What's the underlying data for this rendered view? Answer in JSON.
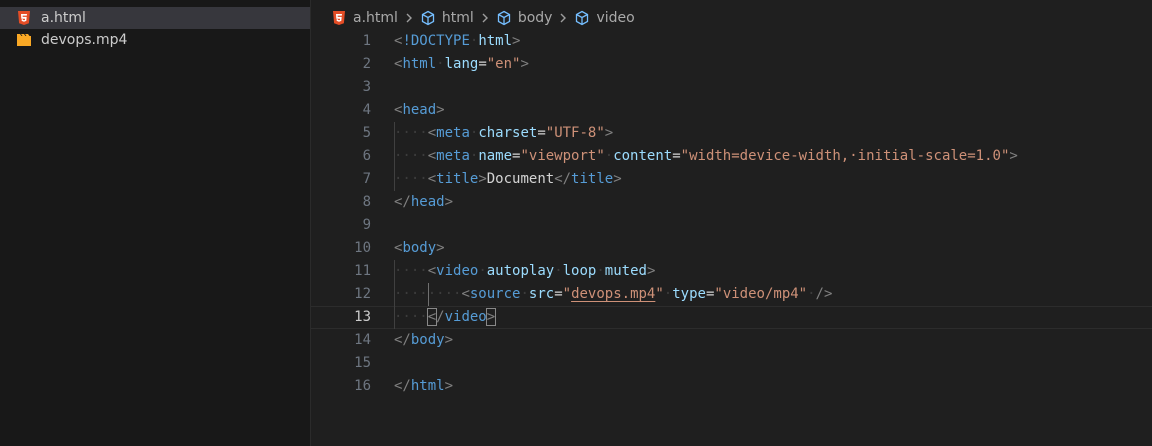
{
  "explorer": {
    "files": [
      {
        "name": "a.html",
        "icon": "html5-icon",
        "selected": true
      },
      {
        "name": "devops.mp4",
        "icon": "video-file-icon",
        "selected": false
      }
    ]
  },
  "breadcrumb": {
    "file": "a.html",
    "items": [
      "html",
      "body",
      "video"
    ]
  },
  "colors": {
    "tag": "#569cd6",
    "attribute": "#9cdcfe",
    "string": "#ce9178",
    "punctuation": "#808080",
    "text": "#d4d4d4",
    "line_number": "#6e7681",
    "html_icon": "#e44d26",
    "video_icon": "#f9a825"
  },
  "code": {
    "current_line": 13,
    "lines": [
      {
        "n": "1",
        "tokens": [
          [
            "pun",
            "<"
          ],
          [
            "tag",
            "!DOCTYPE"
          ],
          [
            "ws",
            "·"
          ],
          [
            "att",
            "html"
          ],
          [
            "pun",
            ">"
          ]
        ]
      },
      {
        "n": "2",
        "tokens": [
          [
            "pun",
            "<"
          ],
          [
            "tag",
            "html"
          ],
          [
            "ws",
            "·"
          ],
          [
            "att",
            "lang"
          ],
          [
            "plain",
            "="
          ],
          [
            "str",
            "\"en\""
          ],
          [
            "pun",
            ">"
          ]
        ]
      },
      {
        "n": "3",
        "tokens": []
      },
      {
        "n": "4",
        "tokens": [
          [
            "pun",
            "<"
          ],
          [
            "tag",
            "head"
          ],
          [
            "pun",
            ">"
          ]
        ]
      },
      {
        "n": "5",
        "tokens": [
          [
            "ws",
            "····"
          ],
          [
            "pun",
            "<"
          ],
          [
            "tag",
            "meta"
          ],
          [
            "ws",
            "·"
          ],
          [
            "att",
            "charset"
          ],
          [
            "plain",
            "="
          ],
          [
            "str",
            "\"UTF-8\""
          ],
          [
            "pun",
            ">"
          ]
        ]
      },
      {
        "n": "6",
        "tokens": [
          [
            "ws",
            "····"
          ],
          [
            "pun",
            "<"
          ],
          [
            "tag",
            "meta"
          ],
          [
            "ws",
            "·"
          ],
          [
            "att",
            "name"
          ],
          [
            "plain",
            "="
          ],
          [
            "str",
            "\"viewport\""
          ],
          [
            "ws",
            "·"
          ],
          [
            "att",
            "content"
          ],
          [
            "plain",
            "="
          ],
          [
            "str",
            "\"width=device-width,·initial-scale=1.0\""
          ],
          [
            "pun",
            ">"
          ]
        ]
      },
      {
        "n": "7",
        "tokens": [
          [
            "ws",
            "····"
          ],
          [
            "pun",
            "<"
          ],
          [
            "tag",
            "title"
          ],
          [
            "pun",
            ">"
          ],
          [
            "plain",
            "Document"
          ],
          [
            "pun",
            "</"
          ],
          [
            "tag",
            "title"
          ],
          [
            "pun",
            ">"
          ]
        ]
      },
      {
        "n": "8",
        "tokens": [
          [
            "pun",
            "</"
          ],
          [
            "tag",
            "head"
          ],
          [
            "pun",
            ">"
          ]
        ]
      },
      {
        "n": "9",
        "tokens": []
      },
      {
        "n": "10",
        "tokens": [
          [
            "pun",
            "<"
          ],
          [
            "tag",
            "body"
          ],
          [
            "pun",
            ">"
          ]
        ]
      },
      {
        "n": "11",
        "tokens": [
          [
            "ws",
            "····"
          ],
          [
            "pun",
            "<"
          ],
          [
            "tag",
            "video"
          ],
          [
            "ws",
            "·"
          ],
          [
            "att",
            "autoplay"
          ],
          [
            "ws",
            "·"
          ],
          [
            "att",
            "loop"
          ],
          [
            "ws",
            "·"
          ],
          [
            "att",
            "muted"
          ],
          [
            "pun",
            ">"
          ]
        ]
      },
      {
        "n": "12",
        "tokens": [
          [
            "ws",
            "········"
          ],
          [
            "pun",
            "<"
          ],
          [
            "tag",
            "source"
          ],
          [
            "ws",
            "·"
          ],
          [
            "att",
            "src"
          ],
          [
            "plain",
            "="
          ],
          [
            "str",
            "\""
          ],
          [
            "stru",
            "devops.mp4"
          ],
          [
            "str",
            "\""
          ],
          [
            "ws",
            "·"
          ],
          [
            "att",
            "type"
          ],
          [
            "plain",
            "="
          ],
          [
            "str",
            "\"video/mp4\""
          ],
          [
            "ws",
            "·"
          ],
          [
            "pun",
            "/>"
          ]
        ]
      },
      {
        "n": "13",
        "tokens": [
          [
            "ws",
            "····"
          ],
          [
            "bpun",
            "<"
          ],
          [
            "pun",
            "/"
          ],
          [
            "tag",
            "video"
          ],
          [
            "bpun",
            ">"
          ]
        ]
      },
      {
        "n": "14",
        "tokens": [
          [
            "pun",
            "</"
          ],
          [
            "tag",
            "body"
          ],
          [
            "pun",
            ">"
          ]
        ]
      },
      {
        "n": "15",
        "tokens": []
      },
      {
        "n": "16",
        "tokens": [
          [
            "pun",
            "</"
          ],
          [
            "tag",
            "html"
          ],
          [
            "pun",
            ">"
          ]
        ]
      }
    ]
  }
}
